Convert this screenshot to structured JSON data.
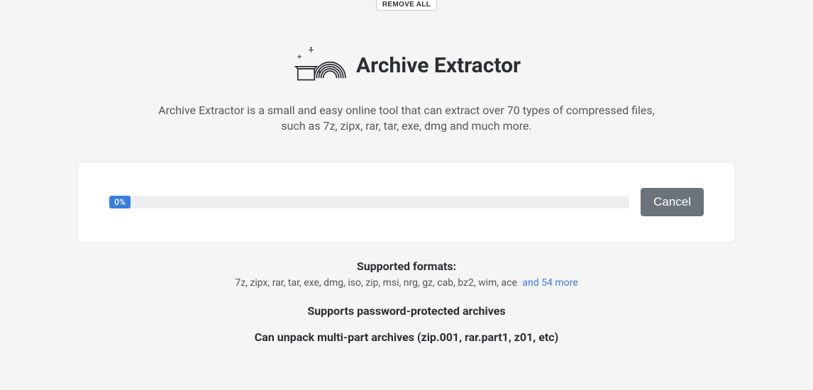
{
  "top": {
    "remove_all_label": "REMOVE ALL"
  },
  "header": {
    "title": "Archive Extractor",
    "subtitle": "Archive Extractor is a small and easy online tool that can extract over 70 types of compressed files, such as 7z, zipx, rar, tar, exe, dmg and much more."
  },
  "progress": {
    "percent_label": "0%",
    "cancel_label": "Cancel"
  },
  "formats": {
    "heading": "Supported formats:",
    "list": "7z, zipx, rar, tar, exe, dmg, iso, zip, msi, nrg, gz, cab, bz2, wim, ace",
    "more": "and 54 more"
  },
  "features": {
    "line1": "Supports password-protected archives",
    "line2": "Can unpack multi-part archives (zip.001, rar.part1, z01, etc)"
  }
}
